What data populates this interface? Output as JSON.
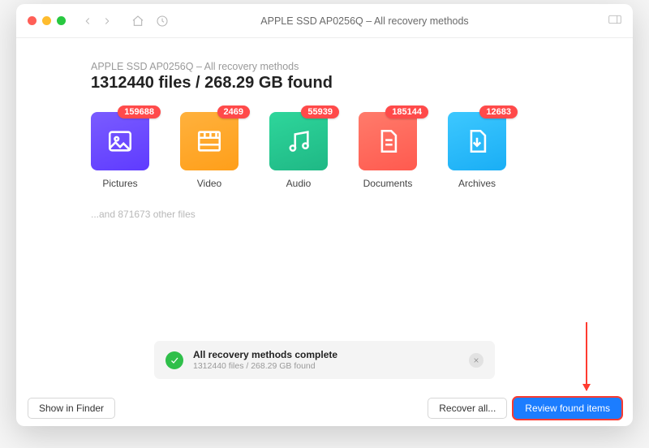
{
  "window": {
    "title": "APPLE SSD AP0256Q – All recovery methods"
  },
  "header": {
    "breadcrumb": "APPLE SSD AP0256Q – All recovery methods",
    "headline": "1312440 files / 268.29 GB found"
  },
  "categories": [
    {
      "id": "pictures",
      "label": "Pictures",
      "count": "159688",
      "tileClass": "t-pictures"
    },
    {
      "id": "video",
      "label": "Video",
      "count": "2469",
      "tileClass": "t-video"
    },
    {
      "id": "audio",
      "label": "Audio",
      "count": "55939",
      "tileClass": "t-audio"
    },
    {
      "id": "documents",
      "label": "Documents",
      "count": "185144",
      "tileClass": "t-documents"
    },
    {
      "id": "archives",
      "label": "Archives",
      "count": "12683",
      "tileClass": "t-archives"
    }
  ],
  "other_files_text": "...and 871673 other files",
  "status": {
    "title": "All recovery methods complete",
    "subtitle": "1312440 files / 268.29 GB found"
  },
  "footer": {
    "show_in_finder": "Show in Finder",
    "recover_all": "Recover all...",
    "review": "Review found items"
  },
  "icons": {
    "pictures": "image-icon",
    "video": "film-icon",
    "audio": "music-icon",
    "documents": "document-icon",
    "archives": "archive-icon"
  }
}
